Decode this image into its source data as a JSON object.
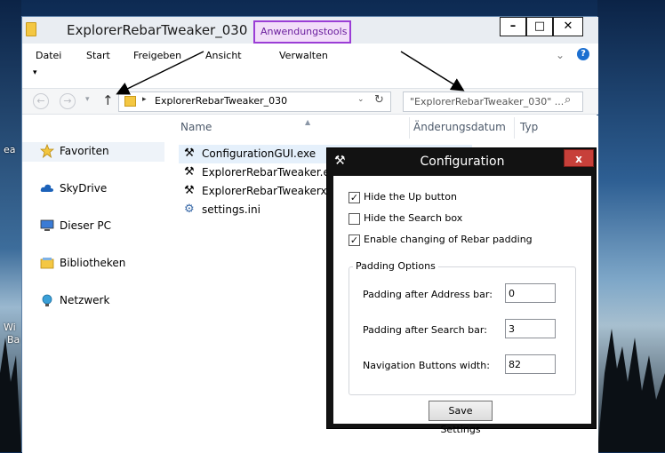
{
  "desktop": {
    "partial_label_top": "ea",
    "partial_label_bottom_1": "Wi",
    "partial_label_bottom_2": "Ba"
  },
  "window": {
    "title": "ExplorerRebarTweaker_030",
    "contextual_tab": "Anwendungstools",
    "controls": {
      "minimize": "–",
      "maximize": "□",
      "close": "✕"
    }
  },
  "ribbon": {
    "tabs": [
      "Datei",
      "Start",
      "Freigeben",
      "Ansicht",
      "Verwalten"
    ],
    "collapse_glyph": "⌄",
    "help_glyph": "?",
    "qat_glyph": "▾"
  },
  "navbar": {
    "back_glyph": "←",
    "forward_glyph": "→",
    "recent_glyph": "▾",
    "up_glyph": "↑",
    "address": "ExplorerRebarTweaker_030",
    "address_chevron": "▸",
    "address_dropdown": "⌄",
    "refresh_glyph": "↻",
    "search_placeholder": "\"ExplorerRebarTweaker_030\" ...",
    "search_glyph": "⌕"
  },
  "navpane": {
    "items": [
      {
        "label": "Favoriten",
        "icon": "star-icon"
      },
      {
        "label": "SkyDrive",
        "icon": "cloud-icon"
      },
      {
        "label": "Dieser PC",
        "icon": "computer-icon"
      },
      {
        "label": "Bibliotheken",
        "icon": "library-icon"
      },
      {
        "label": "Netzwerk",
        "icon": "network-icon"
      }
    ]
  },
  "filelist": {
    "columns": [
      "Name",
      "Änderungsdatum",
      "Typ"
    ],
    "sort_glyph": "▲",
    "files": [
      {
        "name": "ConfigurationGUI.exe",
        "icon": "tools-icon"
      },
      {
        "name": "ExplorerRebarTweaker.exe",
        "icon": "tools-icon"
      },
      {
        "name": "ExplorerRebarTweakerx64.exe",
        "icon": "tools-icon"
      },
      {
        "name": "settings.ini",
        "icon": "settings-file-icon"
      }
    ]
  },
  "dialog": {
    "title": "Configuration",
    "close_glyph": "x",
    "options": [
      {
        "label": "Hide the Up button",
        "checked": true
      },
      {
        "label": "Hide the Search box",
        "checked": false
      },
      {
        "label": "Enable changing of Rebar padding",
        "checked": true
      }
    ],
    "group_title": "Padding Options",
    "fields": [
      {
        "label": "Padding after Address bar:",
        "value": "0"
      },
      {
        "label": "Padding after Search bar:",
        "value": "3"
      },
      {
        "label": "Navigation Buttons width:",
        "value": "82"
      }
    ],
    "save_label": "Save Settings"
  }
}
